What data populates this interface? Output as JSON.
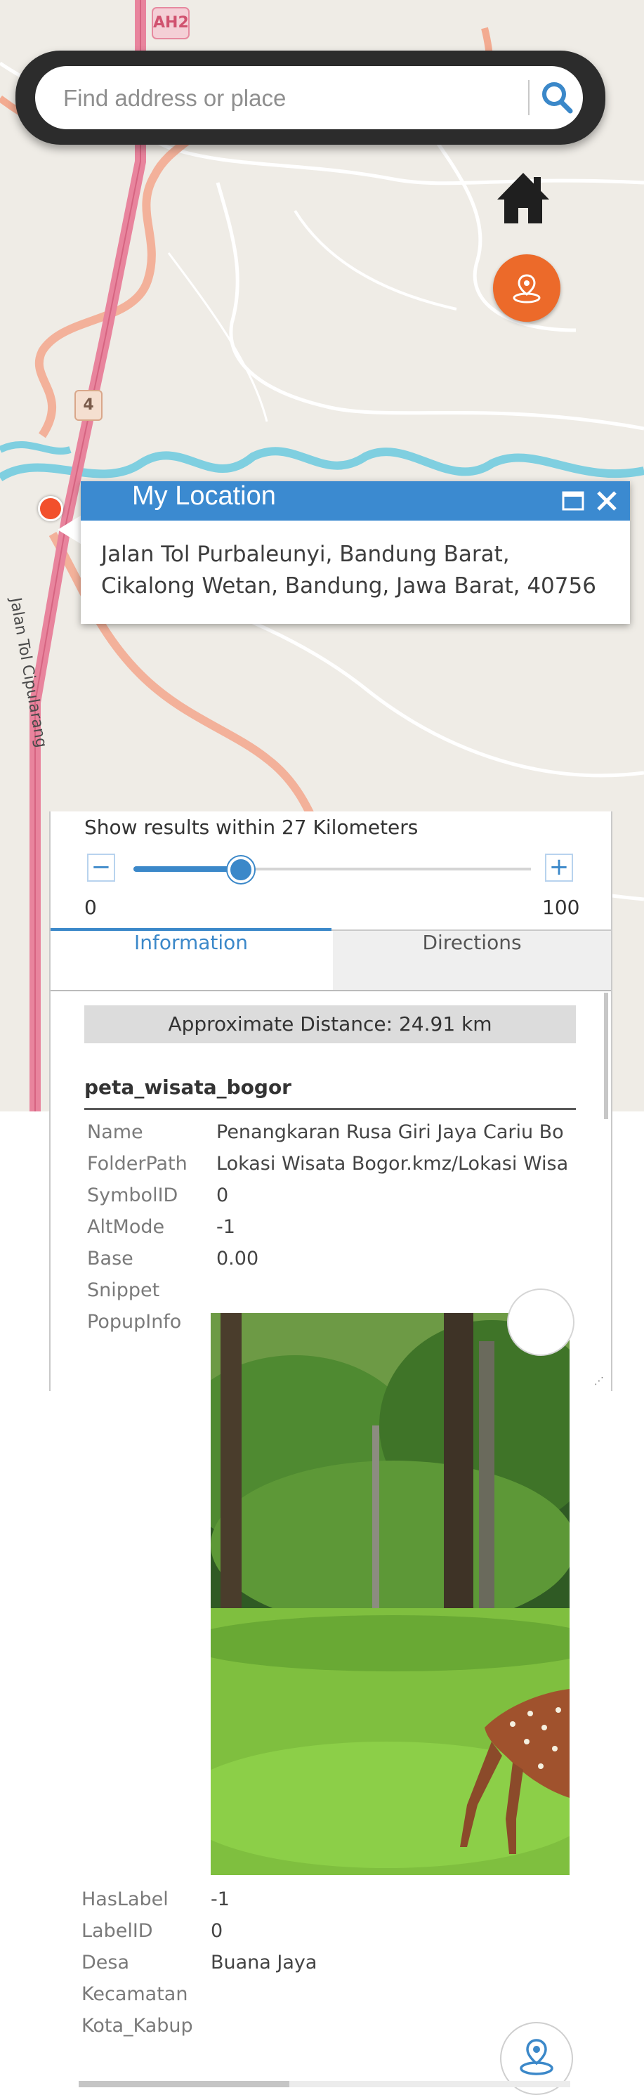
{
  "map": {
    "route_shield": "AH2",
    "road_shield": "4",
    "road_label": "Jalan Tol Cipularang"
  },
  "search": {
    "placeholder": "Find address or place",
    "icon": "search-icon"
  },
  "controls": {
    "home_icon": "home-icon",
    "locate_icon": "locate-icon"
  },
  "popup": {
    "title": "My Location",
    "address_line1": "Jalan Tol Purbaleunyi, Bandung Barat,",
    "address_line2": "Cikalong Wetan, Bandung, Jawa Barat, 40756"
  },
  "panel": {
    "radius_text": "Show results within 27 Kilometers",
    "slider": {
      "min_label": "0",
      "max_label": "100",
      "value": 27,
      "min": 0,
      "max": 100
    },
    "tabs": [
      {
        "label": "Information",
        "active": true
      },
      {
        "label": "Directions",
        "active": false
      }
    ],
    "distance_text": "Approximate Distance: 24.91 km",
    "layer_title": "peta_wisata_bogor",
    "attributes": [
      {
        "label": "Name",
        "value": "Penangkaran Rusa Giri Jaya Cariu Bo"
      },
      {
        "label": "FolderPath",
        "value": "Lokasi Wisata Bogor.kmz/Lokasi Wisa"
      },
      {
        "label": "SymbolID",
        "value": "0"
      },
      {
        "label": "AltMode",
        "value": "-1"
      },
      {
        "label": "Base",
        "value": "0.00"
      },
      {
        "label": "Snippet",
        "value": ""
      },
      {
        "label": "PopupInfo",
        "value": ""
      }
    ],
    "attributes_after_image": [
      {
        "label": "HasLabel",
        "value": "-1"
      },
      {
        "label": "LabelID",
        "value": "0"
      },
      {
        "label": "Desa",
        "value": "Buana Jaya"
      },
      {
        "label": "Kecamatan",
        "value": ""
      },
      {
        "label": "Kota_Kabup",
        "value": ""
      }
    ]
  },
  "colors": {
    "accent": "#3b88c9",
    "header": "#3b8ad0",
    "locate_button": "#ec6a2a",
    "toll_road": "#e8849d",
    "main_road": "#f3ab91",
    "river": "#7fcfe0"
  }
}
